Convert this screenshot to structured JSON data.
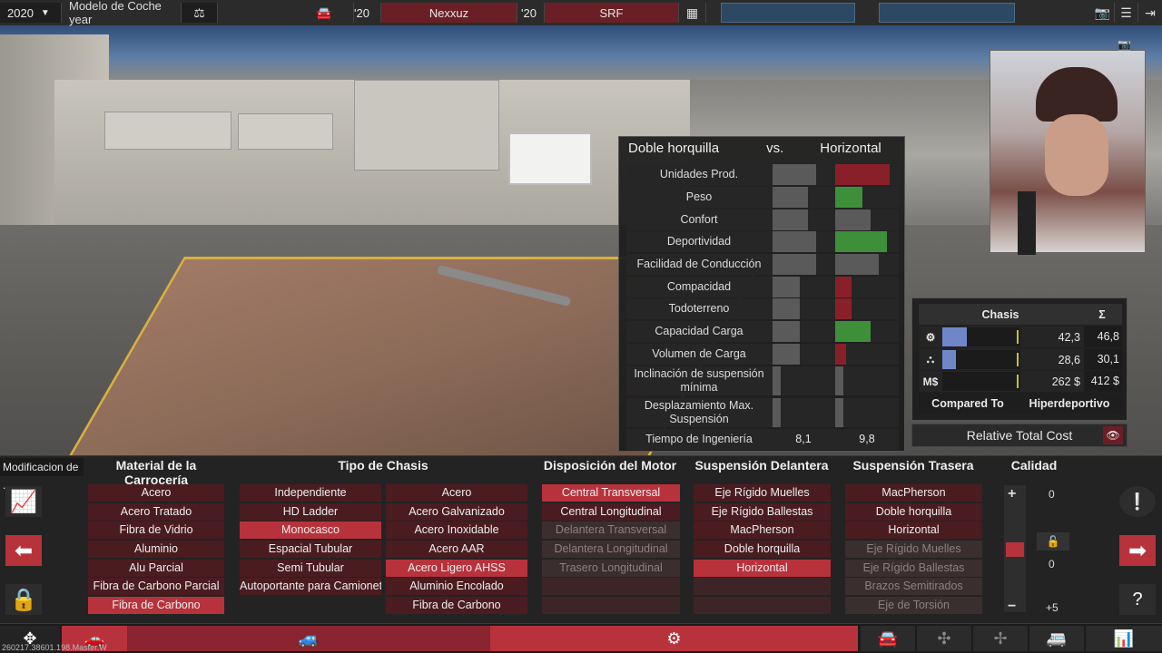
{
  "topbar": {
    "year": "2020",
    "model_label": "Modelo de Coche year",
    "short_year_1": "'20",
    "platform_name": "Nexxuz",
    "short_year_2": "'20",
    "trim_name": "SRF"
  },
  "compare": {
    "left": "Doble horquilla",
    "vs": "vs.",
    "right": "Horizontal",
    "rows": [
      {
        "label": "Unidades Prod.",
        "left_fill": 0.8,
        "right_fill": 1.0,
        "right_color": "#8a2027"
      },
      {
        "label": "Peso",
        "left_fill": 0.65,
        "right_fill": 0.5,
        "right_color": "#3e8f3a"
      },
      {
        "label": "Confort",
        "left_fill": 0.65,
        "right_fill": 0.65,
        "right_color": "#5a5a5a"
      },
      {
        "label": "Deportividad",
        "left_fill": 0.8,
        "right_fill": 0.95,
        "right_color": "#3e8f3a"
      },
      {
        "label": "Facilidad de Conducción",
        "left_fill": 0.8,
        "right_fill": 0.8,
        "right_color": "#5a5a5a"
      },
      {
        "label": "Compacidad",
        "left_fill": 0.5,
        "right_fill": 0.3,
        "right_color": "#8a2027"
      },
      {
        "label": "Todoterreno",
        "left_fill": 0.5,
        "right_fill": 0.3,
        "right_color": "#8a2027"
      },
      {
        "label": "Capacidad Carga",
        "left_fill": 0.5,
        "right_fill": 0.65,
        "right_color": "#3e8f3a"
      },
      {
        "label": "Volumen de Carga",
        "left_fill": 0.5,
        "right_fill": 0.2,
        "right_color": "#8a2027"
      },
      {
        "label": "Inclinación de suspensión mínima",
        "left_fill": 0.15,
        "right_fill": 0.15,
        "right_color": "#5a5a5a"
      },
      {
        "label": "Desplazamiento Max. Suspensión",
        "left_fill": 0.15,
        "right_fill": 0.15,
        "right_color": "#5a5a5a"
      },
      {
        "label": "Tiempo de Ingeniería",
        "left_value": "8,1",
        "right_value": "9,8"
      }
    ]
  },
  "chasis_panel": {
    "title": "Chasis",
    "sigma": "Σ",
    "rows": [
      {
        "icon": "gear-wrench-icon",
        "value": "42,3",
        "sum": "46,8",
        "fill": 0.45
      },
      {
        "icon": "factory-icon",
        "value": "28,6",
        "sum": "30,1",
        "fill": 0.25
      },
      {
        "label": "M$",
        "value": "262 $",
        "sum": "412 $",
        "fill": 0.0
      }
    ],
    "compared_to_label": "Compared To",
    "compared_to_value": "Hiperdeportivo",
    "relative_cost": "Relative Total Cost"
  },
  "bottom": {
    "mod_label": "Modificacion de ..",
    "sections": {
      "material": "Material de la Carrocería",
      "tipo": "Tipo de Chasis",
      "motor": "Disposición del Motor",
      "delantera": "Suspensión Delantera",
      "trasera": "Suspensión Trasera",
      "calidad": "Calidad"
    },
    "material": [
      "Acero",
      "Acero Tratado",
      "Fibra de Vidrio",
      "Aluminio",
      "Alu Parcial",
      "Fibra de Carbono Parcial",
      "Fibra de Carbono"
    ],
    "tipo": [
      "Independiente",
      "HD Ladder",
      "Monocasco",
      "Espacial Tubular",
      "Semi Tubular",
      "Autoportante para Camioneta"
    ],
    "tipo_mat": [
      "Acero",
      "Acero Galvanizado",
      "Acero Inoxidable",
      "Acero AAR",
      "Acero Ligero AHSS",
      "Aluminio Encolado",
      "Fibra de Carbono"
    ],
    "motor": [
      "Central Transversal",
      "Central Longitudinal",
      "Delantera Transversal",
      "Delantera Longitudinal",
      "Trasero Longitudinal"
    ],
    "delantera": [
      "Eje Rígido Muelles",
      "Eje Rígido Ballestas",
      "MacPherson",
      "Doble horquilla",
      "Horizontal"
    ],
    "trasera": [
      "MacPherson",
      "Doble horquilla",
      "Horizontal",
      "Eje Rígido Muelles",
      "Eje Rígido Ballestas",
      "Brazos Semitirados",
      "Eje de Torsión"
    ],
    "calidad_top": "0",
    "calidad_mid": "0",
    "calidad_bottom": "+5",
    "plus": "+",
    "minus": "−"
  },
  "watermark": "260217.38601.198.Master.W"
}
